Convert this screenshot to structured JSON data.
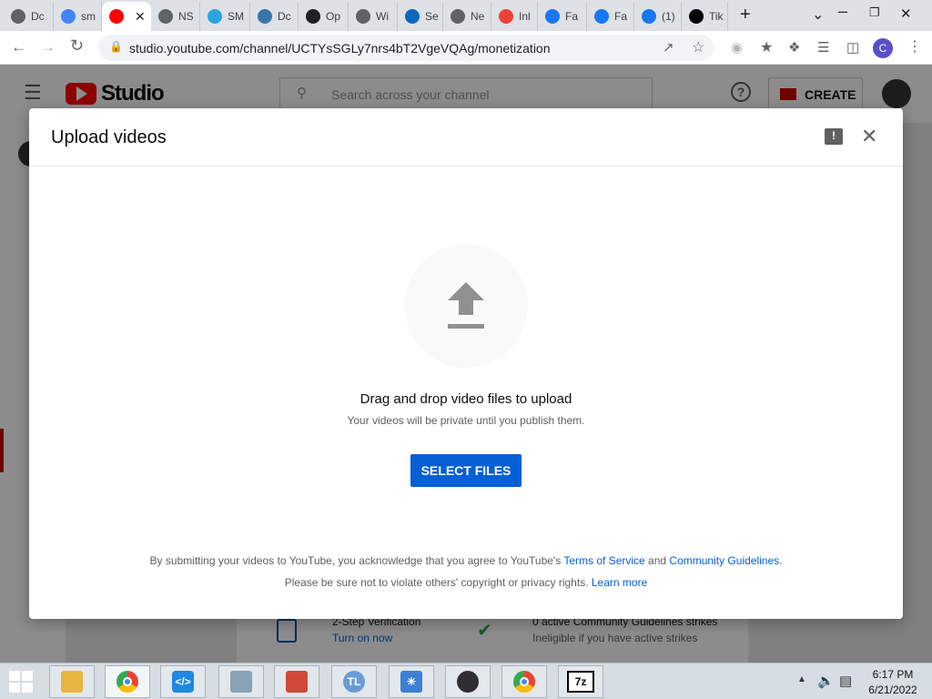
{
  "browser": {
    "tabs": [
      {
        "title": "Dc",
        "icon": "globe-icon",
        "color": "#5f6368"
      },
      {
        "title": "sm",
        "icon": "google-icon",
        "color": "#4285f4"
      },
      {
        "title": "",
        "icon": "youtube-icon",
        "color": "#ff0000",
        "active": true
      },
      {
        "title": "NS",
        "icon": "globe-icon",
        "color": "#5f6368"
      },
      {
        "title": "SM",
        "icon": "telegram-icon",
        "color": "#2aa3e0"
      },
      {
        "title": "Dc",
        "icon": "python-icon",
        "color": "#3776ab"
      },
      {
        "title": "Op",
        "icon": "openai-icon",
        "color": "#202124"
      },
      {
        "title": "Wi",
        "icon": "globe-icon",
        "color": "#5f6368"
      },
      {
        "title": "Se",
        "icon": "linkedin-icon",
        "color": "#0a66c2"
      },
      {
        "title": "Ne",
        "icon": "github-icon",
        "color": "#5f6368"
      },
      {
        "title": "Inl",
        "icon": "gmail-icon",
        "color": "#ea4335"
      },
      {
        "title": "Fa",
        "icon": "facebook-icon",
        "color": "#1877f2"
      },
      {
        "title": "Fa",
        "icon": "facebook-icon",
        "color": "#1877f2"
      },
      {
        "title": "(1)",
        "icon": "facebook-icon",
        "color": "#1877f2"
      },
      {
        "title": "Tik",
        "icon": "tiktok-icon",
        "color": "#000000"
      }
    ],
    "new_tab": "+",
    "url": "studio.youtube.com/channel/UCTYsSGLy7nrs4bT2VgeVQAg/monetization",
    "profile_initial": "C"
  },
  "studio": {
    "logo_text": "Studio",
    "search_placeholder": "Search across your channel",
    "create_label": "CREATE",
    "bg_items": {
      "verification_title": "2-Step Verification",
      "verification_link": "Turn on now",
      "strikes_title": "0 active Community Guidelines strikes",
      "strikes_sub": "Ineligible if you have active strikes"
    }
  },
  "dialog": {
    "title": "Upload videos",
    "drag_text": "Drag and drop video files to upload",
    "private_text": "Your videos will be private until you publish them.",
    "select_button": "SELECT FILES",
    "footer_line1_prefix": "By submitting your videos to YouTube, you acknowledge that you agree to YouTube's",
    "terms_link": "Terms of Service",
    "footer_and": "and",
    "guidelines_link": "Community Guidelines",
    "footer_line1_suffix": ".",
    "footer_line2_prefix": "Please be sure not to violate others' copyright or privacy rights.",
    "learn_more_link": "Learn more"
  },
  "taskbar": {
    "time": "6:17 PM",
    "date": "6/21/2022",
    "apps": [
      "file-explorer-icon",
      "chrome-icon",
      "vscode-icon",
      "task-manager-icon",
      "app-icon",
      "teleport-icon",
      "brightness-icon",
      "obs-icon",
      "chrome-icon",
      "7zip-icon"
    ],
    "zip_label": "7z"
  },
  "colors": {
    "accent": "#065fd4",
    "youtube_red": "#ff0000",
    "tab_strip": "#dee1e6"
  }
}
